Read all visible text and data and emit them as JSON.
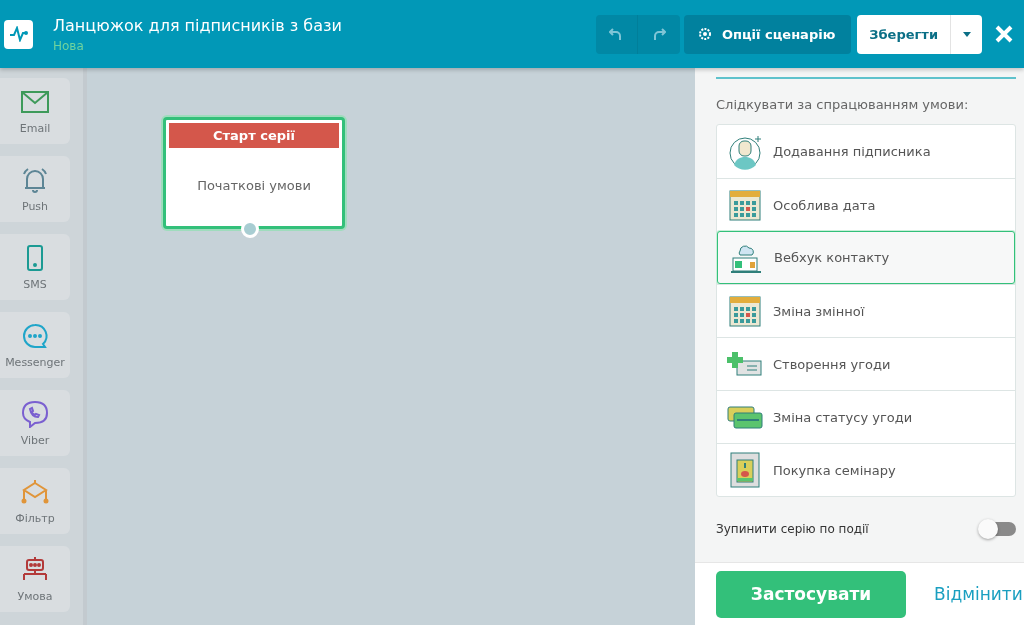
{
  "header": {
    "title": "Ланцюжок для підписників з бази",
    "status": "Нова",
    "options_button": "Опції сценарію",
    "save_button": "Зберегти"
  },
  "tools": [
    {
      "kind": "email",
      "label": "Email"
    },
    {
      "kind": "push",
      "label": "Push"
    },
    {
      "kind": "sms",
      "label": "SMS"
    },
    {
      "kind": "messenger",
      "label": "Messenger"
    },
    {
      "kind": "viber",
      "label": "Viber"
    },
    {
      "kind": "filter",
      "label": "Фільтр"
    },
    {
      "kind": "condition",
      "label": "Умова"
    }
  ],
  "node": {
    "header": "Старт серії",
    "body": "Початкові умови"
  },
  "panel": {
    "prompt": "Слідкувати за спрацюванням умови:",
    "conditions": [
      {
        "kind": "subscriber",
        "label": "Додавання підписника",
        "selected": false
      },
      {
        "kind": "calendar",
        "label": "Особлива дата",
        "selected": false
      },
      {
        "kind": "webhook",
        "label": "Вебхук контакту",
        "selected": true
      },
      {
        "kind": "calendar",
        "label": "Зміна змінної",
        "selected": false
      },
      {
        "kind": "deal",
        "label": "Створення угоди",
        "selected": false
      },
      {
        "kind": "status",
        "label": "Зміна статусу угоди",
        "selected": false
      },
      {
        "kind": "seminar",
        "label": "Покупка семінару",
        "selected": false
      }
    ],
    "stop_toggle": {
      "label": "Зупинити серію по події",
      "on": false
    },
    "apply_button": "Застосувати",
    "cancel_link": "Відмінити"
  }
}
